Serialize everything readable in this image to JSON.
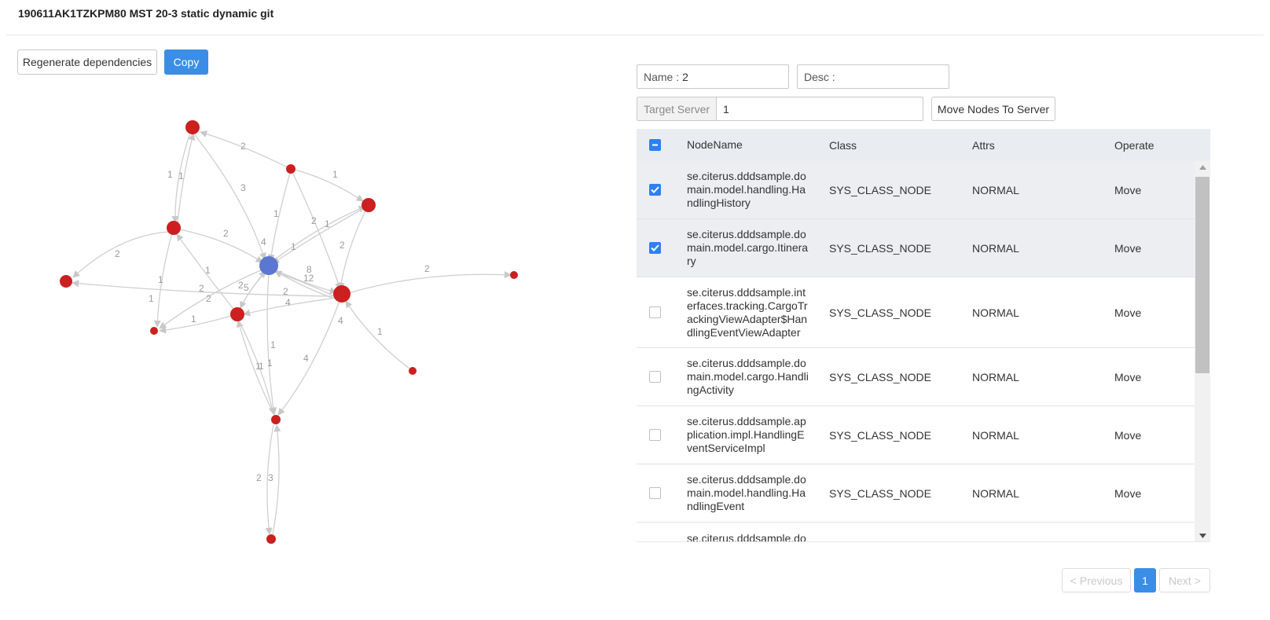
{
  "header": {
    "title": "190611AK1TZKPM80 MST 20-3 static dynamic git"
  },
  "toolbar": {
    "regenerate_label": "Regenerate dependencies",
    "copy_label": "Copy"
  },
  "form": {
    "name_label": "Name :",
    "name_value": "2",
    "desc_label": "Desc :",
    "desc_value": "",
    "target_server_label": "Target Server",
    "target_server_value": "1",
    "move_button_label": "Move Nodes To Server"
  },
  "table": {
    "columns": [
      "NodeName",
      "Class",
      "Attrs",
      "Operate"
    ],
    "rows": [
      {
        "name": "se.citerus.dddsample.domain.model.handling.HandlingHistory",
        "class": "SYS_CLASS_NODE",
        "attrs": "NORMAL",
        "operate": "Move",
        "checked": true
      },
      {
        "name": "se.citerus.dddsample.domain.model.cargo.Itinerary",
        "class": "SYS_CLASS_NODE",
        "attrs": "NORMAL",
        "operate": "Move",
        "checked": true
      },
      {
        "name": "se.citerus.dddsample.interfaces.tracking.CargoTrackingViewAdapter$HandlingEventViewAdapter",
        "class": "SYS_CLASS_NODE",
        "attrs": "NORMAL",
        "operate": "Move",
        "checked": false
      },
      {
        "name": "se.citerus.dddsample.domain.model.cargo.HandlingActivity",
        "class": "SYS_CLASS_NODE",
        "attrs": "NORMAL",
        "operate": "Move",
        "checked": false
      },
      {
        "name": "se.citerus.dddsample.application.impl.HandlingEventServiceImpl",
        "class": "SYS_CLASS_NODE",
        "attrs": "NORMAL",
        "operate": "Move",
        "checked": false
      },
      {
        "name": "se.citerus.dddsample.domain.model.handling.HandlingEvent",
        "class": "SYS_CLASS_NODE",
        "attrs": "NORMAL",
        "operate": "Move",
        "checked": false
      },
      {
        "name": "se.citerus.dddsample.do",
        "class": "",
        "attrs": "",
        "operate": "",
        "checked": false
      }
    ]
  },
  "pagination": {
    "previous_label": "Previous",
    "current_page": "1",
    "next_label": "Next"
  },
  "graph": {
    "colors": {
      "node": "#cc1f1f",
      "selected_node": "#5b77d1",
      "edge": "#cfcfcf"
    },
    "edge_labels": [
      "2",
      "3",
      "1",
      "1",
      "1",
      "1",
      "1",
      "2",
      "2",
      "1",
      "2",
      "4",
      "2",
      "1",
      "2",
      "8",
      "12",
      "2",
      "1",
      "1",
      "2",
      "2",
      "4",
      "2",
      "1",
      "1",
      "4",
      "1",
      "1",
      "4",
      "1",
      "1",
      "2",
      "3",
      "5"
    ]
  }
}
